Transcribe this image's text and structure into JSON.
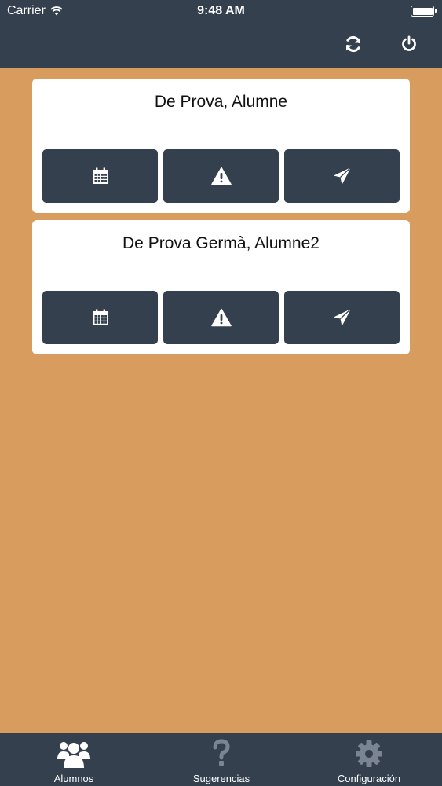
{
  "status_bar": {
    "carrier": "Carrier",
    "time": "9:48 AM"
  },
  "nav": {
    "actions": [
      {
        "icon": "refresh-icon"
      },
      {
        "icon": "power-icon"
      }
    ]
  },
  "students": [
    {
      "name": "De Prova, Alumne",
      "actions": [
        "calendar-icon",
        "warning-icon",
        "send-icon"
      ]
    },
    {
      "name": "De Prova Germà, Alumne2",
      "actions": [
        "calendar-icon",
        "warning-icon",
        "send-icon"
      ]
    }
  ],
  "tabbar": {
    "tabs": [
      {
        "label": "Alumnos",
        "icon": "users-icon",
        "active": true
      },
      {
        "label": "Sugerencias",
        "icon": "question-icon",
        "active": false
      },
      {
        "label": "Configuración",
        "icon": "gear-icon",
        "active": false
      }
    ]
  },
  "colors": {
    "background": "#d99c5f",
    "navbar": "#35404f",
    "button": "#35404f",
    "card": "#ffffff",
    "tab_active": "#ffffff",
    "tab_inactive": "#7b8591"
  }
}
